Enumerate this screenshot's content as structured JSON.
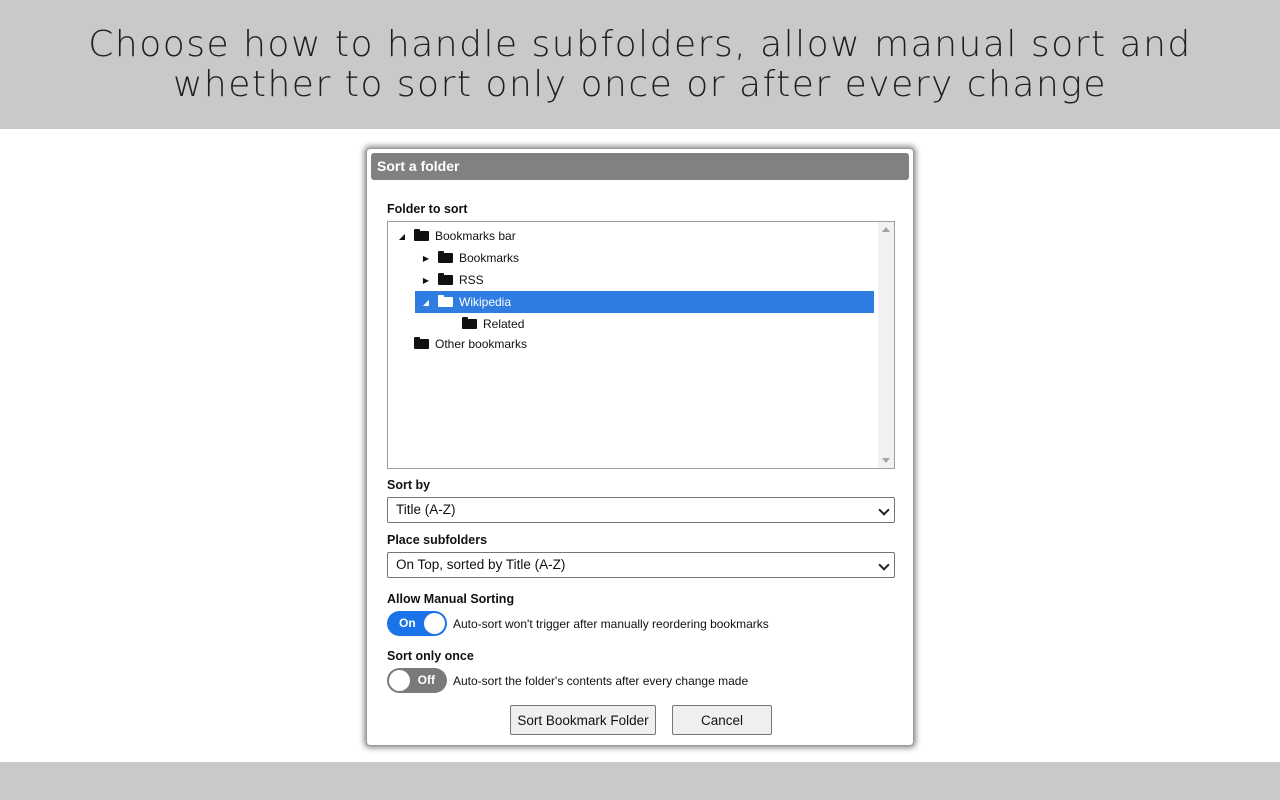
{
  "banner": {
    "text": "Choose how to handle subfolders, allow manual sort and\nwhether to sort only once or after every change"
  },
  "dialog": {
    "title": "Sort a folder",
    "folder_label": "Folder to sort",
    "tree": [
      {
        "label": "Bookmarks bar",
        "toggle": "◢"
      },
      {
        "label": "Bookmarks",
        "toggle": "▶"
      },
      {
        "label": "RSS",
        "toggle": "▶"
      },
      {
        "label": "Wikipedia",
        "toggle": "◢"
      },
      {
        "label": "Related",
        "toggle": ""
      },
      {
        "label": "Other bookmarks",
        "toggle": ""
      }
    ],
    "sort_by": {
      "label": "Sort by",
      "value": "Title (A-Z)"
    },
    "subfolders": {
      "label": "Place subfolders",
      "value": "On Top, sorted by Title (A-Z)"
    },
    "manual": {
      "label": "Allow Manual Sorting",
      "state": "On",
      "desc": "Auto-sort won't trigger after manually reordering bookmarks"
    },
    "once": {
      "label": "Sort only once",
      "state": "Off",
      "desc": "Auto-sort the folder's contents after every change made"
    },
    "buttons": {
      "sort": "Sort Bookmark Folder",
      "cancel": "Cancel"
    }
  },
  "colors": {
    "selection": "#2f7de1",
    "switch_on": "#1a73e8",
    "switch_off": "#7a7a7a",
    "titlebar": "#818181"
  }
}
